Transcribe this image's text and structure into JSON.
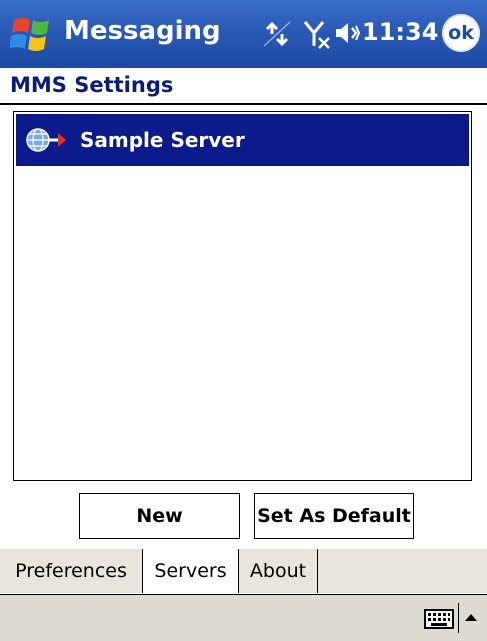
{
  "titlebar": {
    "app_title": "Messaging",
    "time": "11:34",
    "ok_label": "ok",
    "icons": [
      "windows-start-icon",
      "connectivity-icon",
      "signal-off-icon",
      "speaker-icon"
    ]
  },
  "page": {
    "title": "MMS Settings"
  },
  "server_list": {
    "items": [
      {
        "label": "Sample Server",
        "selected": true,
        "icon": "server-globe-icon"
      }
    ]
  },
  "buttons": {
    "new_label": "New",
    "set_default_label": "Set As Default"
  },
  "tabs": [
    {
      "label": "Preferences",
      "active": false
    },
    {
      "label": "Servers",
      "active": true
    },
    {
      "label": "About",
      "active": false
    }
  ],
  "menubar": {
    "icons": [
      "keyboard-icon",
      "sip-arrow-up-icon"
    ]
  },
  "colors": {
    "titlebar": "#1c4aa4",
    "selection": "#0d1a8c",
    "heading": "#0b1b7a",
    "tab_inactive": "#e8e6dc",
    "menubar": "#dedbd0"
  }
}
